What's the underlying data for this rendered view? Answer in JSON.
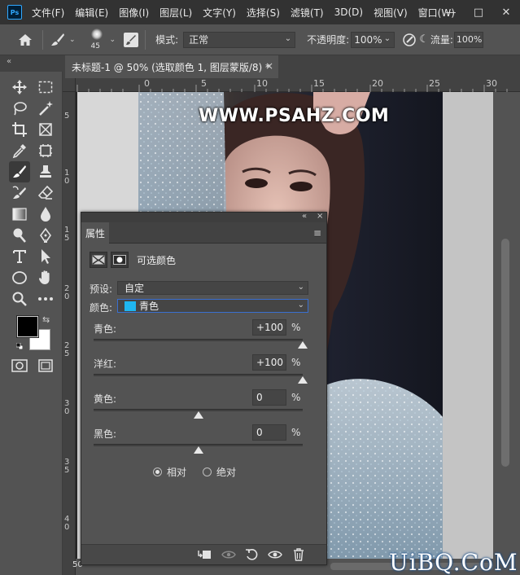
{
  "app": {
    "logo_text": "Ps"
  },
  "menu": [
    "文件(F)",
    "编辑(E)",
    "图像(I)",
    "图层(L)",
    "文字(Y)",
    "选择(S)",
    "滤镜(T)",
    "3D(D)",
    "视图(V)",
    "窗口(W)"
  ],
  "window_controls": {
    "minimize": "—",
    "maximize": "□",
    "close": "✕"
  },
  "options": {
    "brush_size": "45",
    "mode_label": "模式:",
    "mode_value": "正常",
    "opacity_label": "不透明度:",
    "opacity_value": "100%",
    "flow_label": "流量:",
    "flow_value": "100%"
  },
  "toolbar": {
    "collapse": "«",
    "tools": [
      "move-icon",
      "marquee-icon",
      "lasso-icon",
      "magic-wand-icon",
      "crop-icon",
      "frame-icon",
      "eyedropper-icon",
      "patch-icon",
      "brush-icon",
      "stamp-icon",
      "history-brush-icon",
      "eraser-icon",
      "gradient-icon",
      "blur-icon",
      "dodge-icon",
      "pen-icon",
      "type-icon",
      "path-select-icon",
      "ellipse-icon",
      "hand-icon",
      "zoom-icon",
      "more-icon"
    ],
    "foreground_color": "#000000",
    "background_color": "#ffffff"
  },
  "document": {
    "tab_title": "未标题-1 @ 50% (选取颜色 1, 图层蒙版/8) *",
    "tab_close": "×",
    "zoom": "50",
    "ruler_h": [
      "0",
      "5",
      "10",
      "15",
      "20",
      "25",
      "30"
    ],
    "ruler_v": [
      "5",
      "1\n0",
      "1\n5",
      "2\n0",
      "2\n5",
      "3\n0",
      "3\n5",
      "4\n0"
    ]
  },
  "watermarks": {
    "top": "WWW.PSAHZ.COM",
    "bottom": "UiBQ.CoM"
  },
  "panel": {
    "controls": [
      "«",
      "×"
    ],
    "tab_label": "属性",
    "menu_icon": "≡",
    "adjustment_title": "可选颜色",
    "preset_label": "预设:",
    "preset_value": "自定",
    "color_label": "颜色:",
    "color_value": "青色",
    "color_swatch": "#1fb6ef",
    "sliders": [
      {
        "label": "青色:",
        "value": "+100",
        "unit": "%",
        "level": 100
      },
      {
        "label": "洋红:",
        "value": "+100",
        "unit": "%",
        "level": 100
      },
      {
        "label": "黄色:",
        "value": "0",
        "unit": "%",
        "level": 0
      },
      {
        "label": "黑色:",
        "value": "0",
        "unit": "%",
        "level": 0
      }
    ],
    "method_relative": "相对",
    "method_absolute": "绝对",
    "method_selected": "relative"
  }
}
